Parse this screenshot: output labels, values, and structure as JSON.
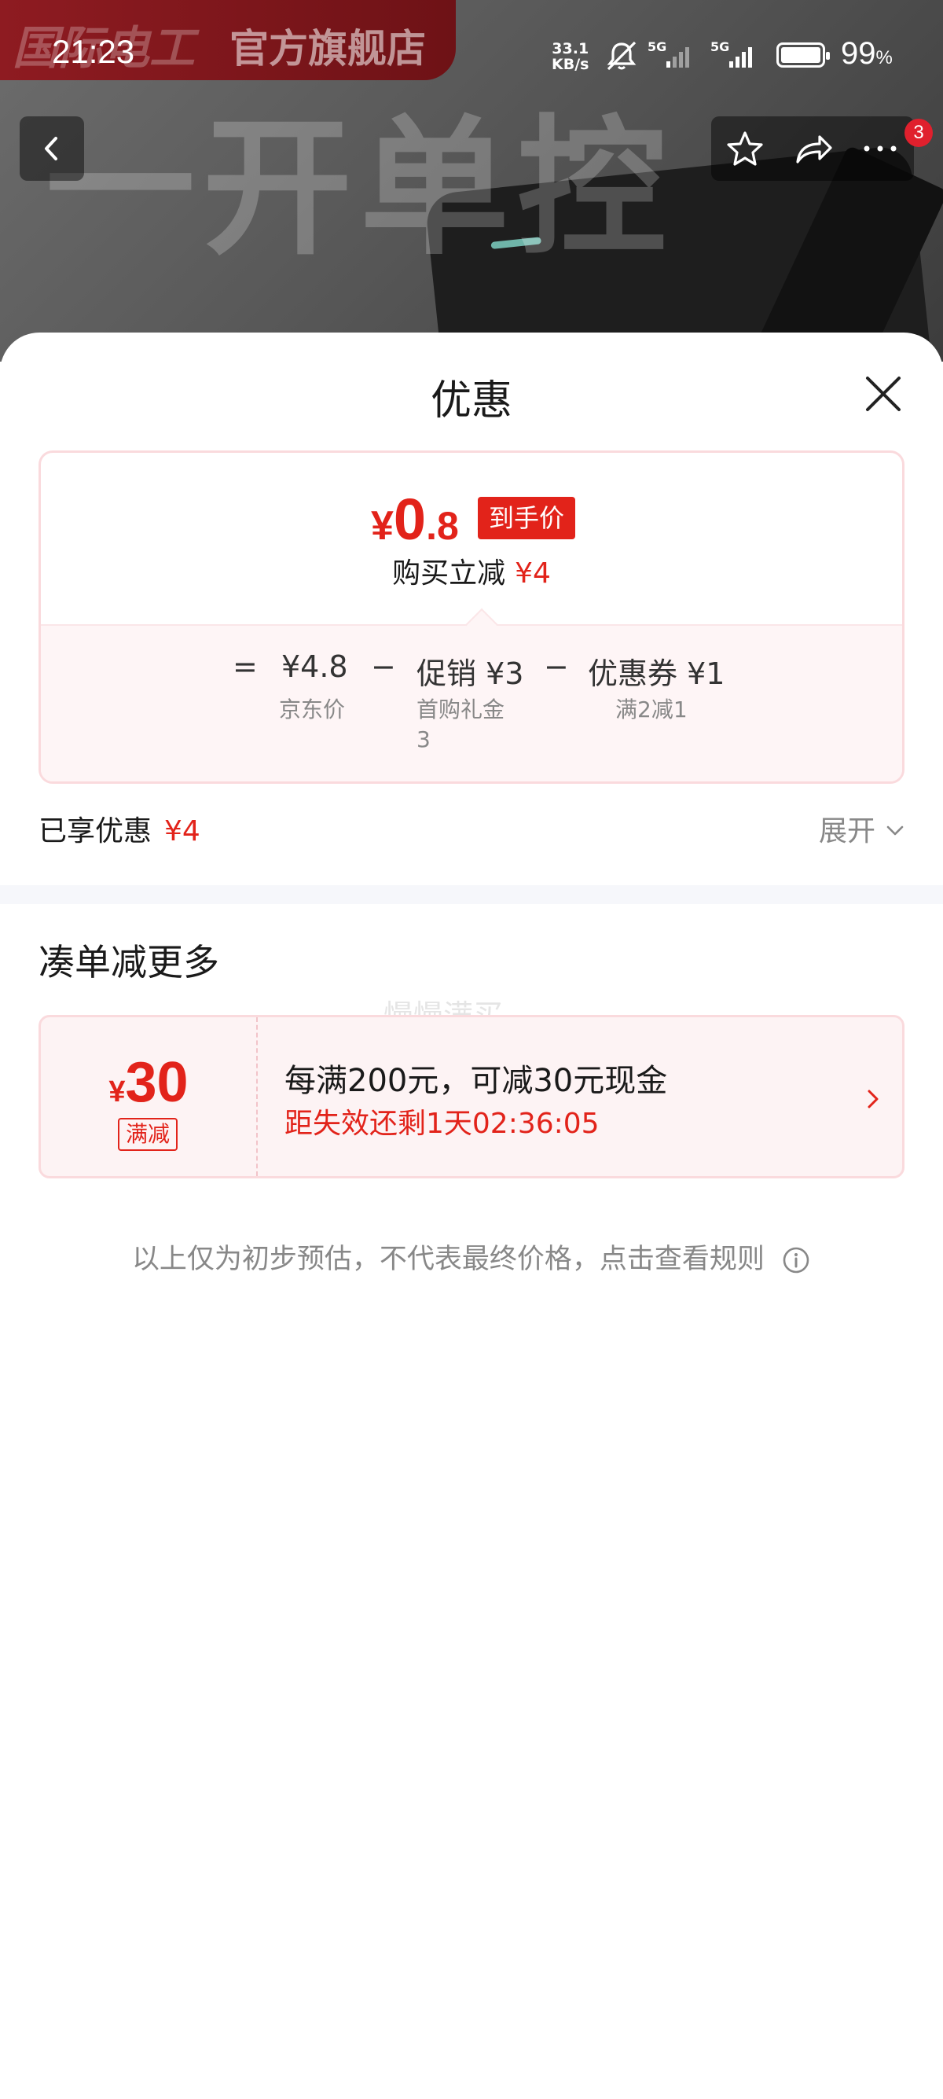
{
  "status_bar": {
    "time": "21:23",
    "net_speed_value": "33.1",
    "net_speed_unit": "KB/s",
    "sim1_label": "5G",
    "sim2_label": "5G",
    "battery_percent": "99",
    "battery_unit": "%"
  },
  "background": {
    "store_brand": "国际电工",
    "store_name": "官方旗舰店",
    "product_text": "一开单控"
  },
  "top_actions": {
    "badge_count": "3",
    "icons": [
      "back-icon",
      "star-icon",
      "share-icon",
      "more-icon"
    ]
  },
  "sheet": {
    "title": "优惠",
    "price_card": {
      "final_price_symbol": "¥",
      "final_price_int": "0",
      "final_price_dec": ".8",
      "final_price_tag": "到手价",
      "buy_save_label": "购买立减",
      "buy_save_amount": "¥4",
      "breakdown": {
        "equals": "=",
        "jd_price": "¥4.8",
        "jd_price_label": "京东价",
        "minus": "−",
        "promo": "促销 ¥3",
        "promo_label_line1": "首购礼金",
        "promo_label_line2": "3",
        "coupon": "优惠券 ¥1",
        "coupon_label": "满2减1"
      }
    },
    "enjoyed_label": "已享优惠",
    "enjoyed_amount": "¥4",
    "expand_label": "展开",
    "section_title": "凑单减更多",
    "watermark": "慢慢满买",
    "coupon": {
      "symbol": "¥",
      "amount": "30",
      "tag": "满减",
      "description": "每满200元，可减30元现金",
      "timer": "距失效还剩1天02:36:05"
    },
    "disclaimer": "以上仅为初步预估，不代表最终价格，点击查看规则"
  },
  "colors": {
    "accent_red": "#e2231a",
    "card_border": "#fadadd",
    "card_bg": "#fef5f6"
  }
}
